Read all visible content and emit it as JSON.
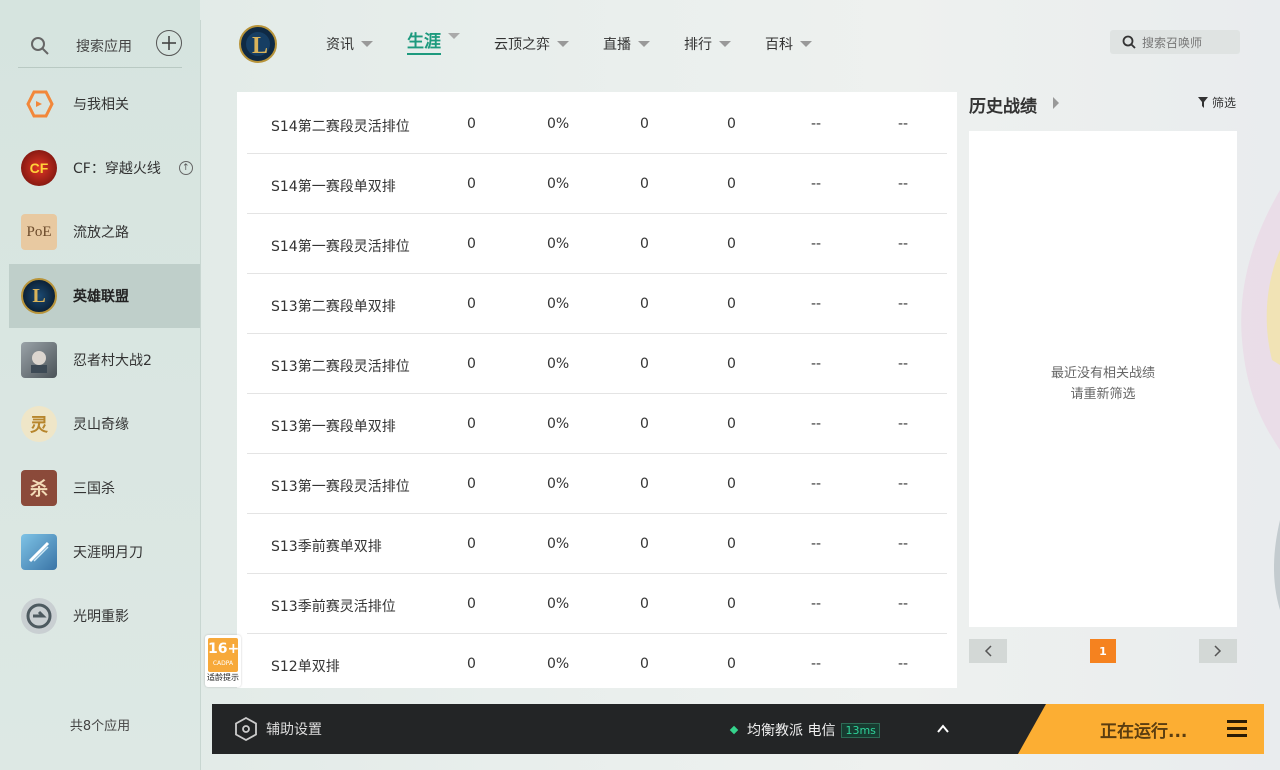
{
  "sidebar": {
    "search_label": "搜索应用",
    "apps": [
      {
        "label": "与我相关",
        "icon": "orange-hex-icon"
      },
      {
        "label": "CF：穿越火线",
        "icon": "crossfire-icon",
        "has_update": true
      },
      {
        "label": "流放之路",
        "icon": "poe-icon"
      },
      {
        "label": "英雄联盟",
        "icon": "lol-icon",
        "active": true
      },
      {
        "label": "忍者村大战2",
        "icon": "ninja-icon"
      },
      {
        "label": "灵山奇缘",
        "icon": "lingshan-icon"
      },
      {
        "label": "三国杀",
        "icon": "sanguosha-icon"
      },
      {
        "label": "天涯明月刀",
        "icon": "tianya-icon"
      },
      {
        "label": "光明重影",
        "icon": "guangming-icon"
      }
    ],
    "count_label": "共8个应用"
  },
  "nav": {
    "items": [
      {
        "label": "资讯"
      },
      {
        "label": "生涯",
        "active": true
      },
      {
        "label": "云顶之弈"
      },
      {
        "label": "直播"
      },
      {
        "label": "排行"
      },
      {
        "label": "百科"
      }
    ],
    "search_placeholder": "搜索召唤师"
  },
  "table": {
    "rows": [
      {
        "name": "S14第二赛段灵活排位",
        "c1": "0",
        "c2": "0%",
        "c3": "0",
        "c4": "0",
        "c5": "--",
        "c6": "--"
      },
      {
        "name": "S14第一赛段单双排",
        "c1": "0",
        "c2": "0%",
        "c3": "0",
        "c4": "0",
        "c5": "--",
        "c6": "--"
      },
      {
        "name": "S14第一赛段灵活排位",
        "c1": "0",
        "c2": "0%",
        "c3": "0",
        "c4": "0",
        "c5": "--",
        "c6": "--"
      },
      {
        "name": "S13第二赛段单双排",
        "c1": "0",
        "c2": "0%",
        "c3": "0",
        "c4": "0",
        "c5": "--",
        "c6": "--"
      },
      {
        "name": "S13第二赛段灵活排位",
        "c1": "0",
        "c2": "0%",
        "c3": "0",
        "c4": "0",
        "c5": "--",
        "c6": "--"
      },
      {
        "name": "S13第一赛段单双排",
        "c1": "0",
        "c2": "0%",
        "c3": "0",
        "c4": "0",
        "c5": "--",
        "c6": "--"
      },
      {
        "name": "S13第一赛段灵活排位",
        "c1": "0",
        "c2": "0%",
        "c3": "0",
        "c4": "0",
        "c5": "--",
        "c6": "--"
      },
      {
        "name": "S13季前赛单双排",
        "c1": "0",
        "c2": "0%",
        "c3": "0",
        "c4": "0",
        "c5": "--",
        "c6": "--"
      },
      {
        "name": "S13季前赛灵活排位",
        "c1": "0",
        "c2": "0%",
        "c3": "0",
        "c4": "0",
        "c5": "--",
        "c6": "--"
      },
      {
        "name": "S12单双排",
        "c1": "0",
        "c2": "0%",
        "c3": "0",
        "c4": "0",
        "c5": "--",
        "c6": "--"
      }
    ]
  },
  "age_badge": {
    "rating": "16+",
    "org": "CADPA",
    "caption": "适龄提示"
  },
  "history": {
    "title": "历史战绩",
    "filter_label": "筛选",
    "empty_line1": "最近没有相关战绩",
    "empty_line2": "请重新筛选",
    "page": "1"
  },
  "bottom": {
    "assist_label": "辅助设置",
    "server": "均衡教派 电信",
    "ping": "13ms",
    "run_label": "正在运行..."
  },
  "colors": {
    "accent": "#1d9a7e",
    "run_button": "#fcae33",
    "page_active": "#f5821f",
    "bottom_bar": "#232526"
  }
}
